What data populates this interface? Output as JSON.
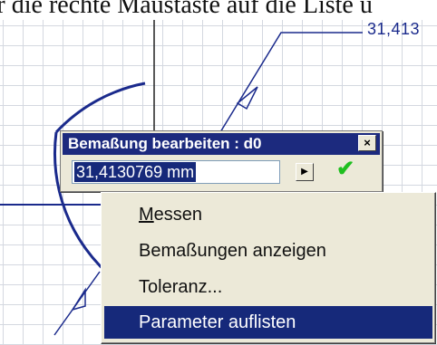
{
  "caption": {
    "text": "er die rechte Maustaste auf die Liste u"
  },
  "drawing": {
    "dimension_value": "31,413"
  },
  "dialog": {
    "title": "Bemaßung bearbeiten : d0",
    "value": "31,4130769 mm",
    "close_symbol": "×",
    "arrow_symbol": "▶",
    "accept_symbol": "✔"
  },
  "context_menu": {
    "items": [
      {
        "accel": "M",
        "rest": "essen",
        "selected": false
      },
      {
        "accel": "",
        "rest": "Bemaßungen anzeigen",
        "selected": false
      },
      {
        "accel": "",
        "rest": "Toleranz...",
        "selected": false
      },
      {
        "accel": "",
        "rest": "Parameter auflisten",
        "selected": true
      }
    ]
  },
  "colors": {
    "drawing_line": "#1a2a8c",
    "title_bar": "#1c2a7e",
    "selection": "#16297a",
    "accept": "#1fbf1f"
  }
}
